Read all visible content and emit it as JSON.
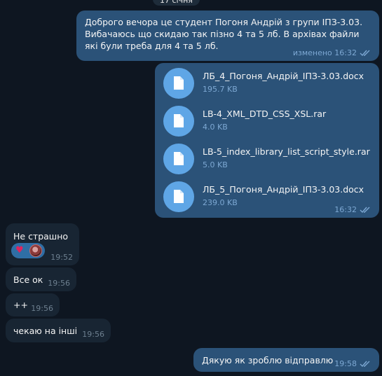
{
  "date_separator": "17 січня",
  "messages": {
    "m1": {
      "text": "Доброго вечора це студент Погоня Андрій з групи ІПЗ-3.03. Вибачаюсь що скидаю так пізно 4 та 5 лб. В архівах файли які були треба для 4 та 5 лб.",
      "edited_time": "изменено 16:32"
    },
    "files": {
      "items": [
        {
          "name": "ЛБ_4_Погоня_Андрій_ІПЗ-3.03.docx",
          "size": "195.7 KB"
        },
        {
          "name": "LB-4_XML_DTD_CSS_XSL.rar",
          "size": "4.0 KB"
        },
        {
          "name": "LB-5_index_library_list_script_style.rar",
          "size": "5.0 KB"
        },
        {
          "name": "ЛБ_5_Погоня_Андрій_ІПЗ-3.03.docx",
          "size": "239.0 KB"
        }
      ],
      "time": "16:32"
    },
    "m2": {
      "text": "Не страшно",
      "time": "19:52",
      "reaction": "heart"
    },
    "m3": {
      "text": "Все ок",
      "time": "19:56"
    },
    "m4": {
      "text": "++",
      "time": "19:56"
    },
    "m5": {
      "text": "чекаю на інші",
      "time": "19:56"
    },
    "m6": {
      "text": "Дякую як зроблю відправлю",
      "time": "19:58"
    }
  },
  "colors": {
    "background": "#0e1621",
    "outgoing_bubble": "#2b5278",
    "incoming_bubble": "#182533",
    "file_icon": "#5fa6e6",
    "read_checks": "#7da8d3"
  },
  "icons": [
    "document-icon",
    "double-check-icon",
    "heart-reaction-icon",
    "avatar"
  ]
}
